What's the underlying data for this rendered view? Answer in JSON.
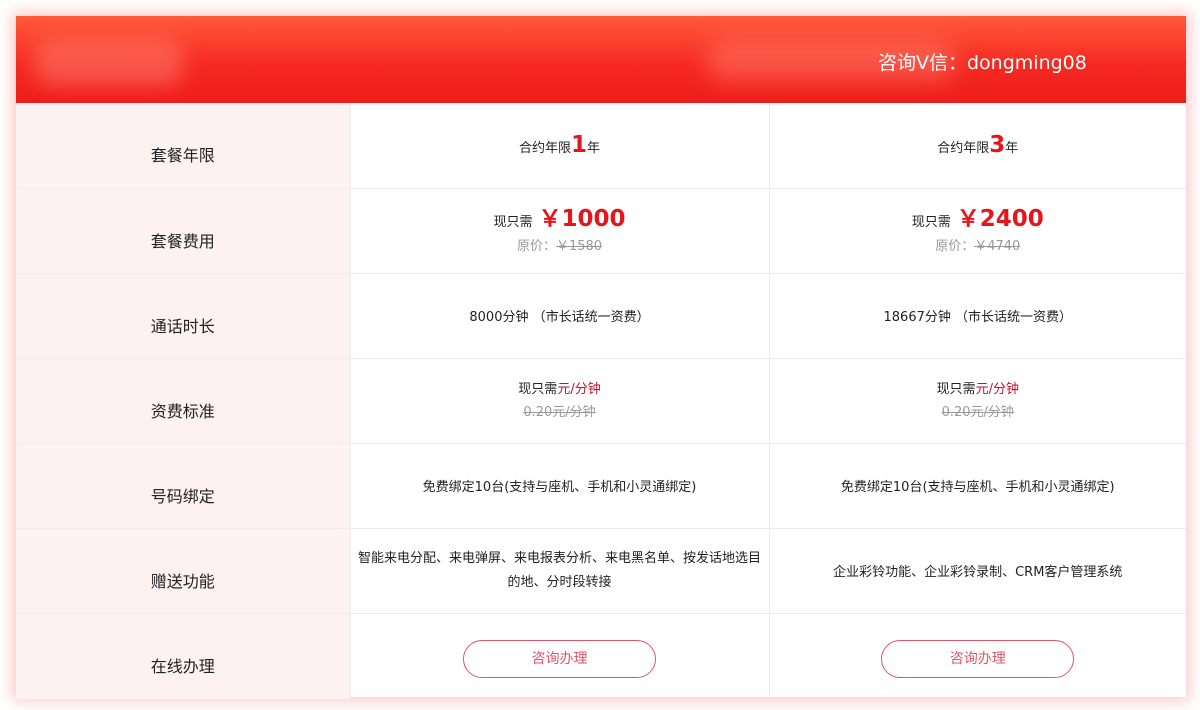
{
  "header": {
    "contact_text": "咨询V信：dongming08"
  },
  "colors": {
    "header_red": "#f62a22",
    "accent_red": "#e8141c",
    "label_bg": "#fdf1f1",
    "button_border": "#e0556a"
  },
  "rows": {
    "term": {
      "label": "套餐年限",
      "plan1": {
        "prefix": "合约年限",
        "num": "1",
        "suffix": "年"
      },
      "plan2": {
        "prefix": "合约年限",
        "num": "3",
        "suffix": "年"
      }
    },
    "fee": {
      "label": "套餐费用",
      "plan1": {
        "now_prefix": "现只需",
        "price": "￥1000",
        "orig_prefix": "原价：",
        "orig": "￥1580"
      },
      "plan2": {
        "now_prefix": "现只需",
        "price": "￥2400",
        "orig_prefix": "原价：",
        "orig": "￥4740"
      }
    },
    "minutes": {
      "label": "通话时长",
      "plan1": "8000分钟  （市长话统一资费）",
      "plan2": "18667分钟  （市长话统一资费）"
    },
    "rate": {
      "label": "资费标准",
      "plan1": {
        "now_prefix": "现只需",
        "now_unit": "元/分钟",
        "orig": "0.20元/分钟"
      },
      "plan2": {
        "now_prefix": "现只需",
        "now_unit": "元/分钟",
        "orig": "0.20元/分钟"
      }
    },
    "binding": {
      "label": "号码绑定",
      "plan1": "免费绑定10台(支持与座机、手机和小灵通绑定)",
      "plan2": "免费绑定10台(支持与座机、手机和小灵通绑定)"
    },
    "gifts": {
      "label": "赠送功能",
      "plan1": "智能来电分配、来电弹屏、来电报表分析、来电黑名单、按发话地选目的地、分时段转接",
      "plan2": "企业彩铃功能、企业彩铃录制、CRM客户管理系统"
    },
    "online": {
      "label": "在线办理",
      "plan1_button": "咨询办理",
      "plan2_button": "咨询办理"
    }
  }
}
